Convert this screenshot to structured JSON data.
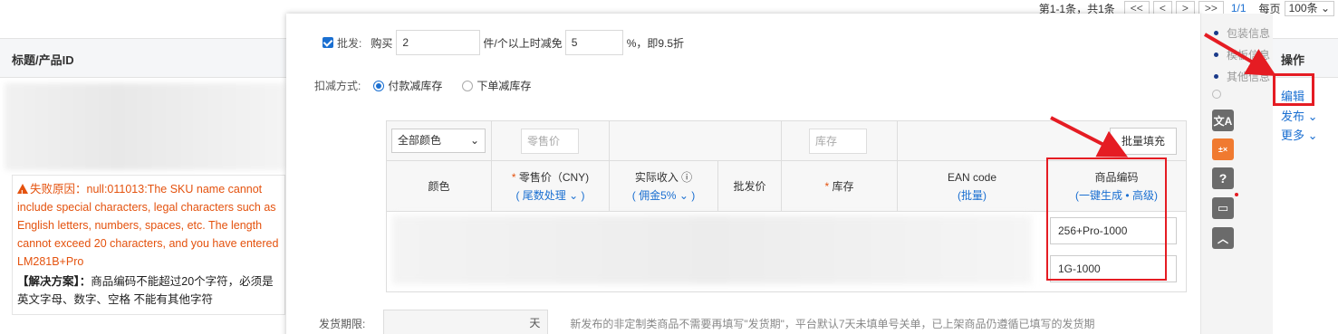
{
  "pager": {
    "info": "第1-1条，共1条",
    "first": "<<",
    "prev": "<",
    "next": ">",
    "last": ">>",
    "current": "1/1",
    "per_label": "每页",
    "per_value": "100条"
  },
  "list": {
    "col_title": "标题/产品ID",
    "col_ops": "操作",
    "error_text": "失败原因：null:011013:The SKU name cannot include special characters, legal characters such as English letters, numbers, spaces, etc. The length cannot exceed 20 characters, and you have entered LM281B+Pro",
    "solution_label": "【解决方案】：",
    "solution_text": "商品编码不能超过20个字符，必须是英文字母、数字、空格 不能有其他字符",
    "op_edit": "编辑",
    "op_publish": "发布",
    "op_more": "更多"
  },
  "modal": {
    "wholesale_label": "批发:",
    "buy_label": "购买",
    "buy_qty": "2",
    "unit_text": "件/个以上时减免",
    "discount": "5",
    "discount_suffix": "%，即9.5折",
    "deduct_label": "扣减方式:",
    "opt_pay": "付款减库存",
    "opt_order": "下单减库存",
    "color_select": "全部颜色",
    "retail_placeholder": "零售价",
    "stock_placeholder": "库存",
    "batch_fill": "批量填充",
    "headers": {
      "color": "颜色",
      "retail": "零售价（CNY)",
      "retail_sub": "( 尾数处理",
      "income": "实际收入",
      "income_sub": "( 佣金5%",
      "wholesale": "批发价",
      "stock": "库存",
      "ean": "EAN code",
      "ean_sub": "(批量)",
      "code": "商品编码",
      "code_gen": "一键生成",
      "code_adv": "高级"
    },
    "rows": [
      {
        "code": "256+Pro-1000"
      },
      {
        "code": "1G-1000"
      }
    ],
    "ship_label": "发货期限:",
    "ship_unit": "天",
    "ship_note": "新发布的非定制类商品不需要再填写\"发货期\"，平台默认7天未填单号关单，已上架商品仍遵循已填写的发货期"
  },
  "rail": {
    "items": [
      "包装信息",
      "模板信息",
      "其他信息"
    ]
  },
  "colors": {
    "accent": "#1a6fd1",
    "error": "#e4520e",
    "annotation": "#e51c23"
  }
}
